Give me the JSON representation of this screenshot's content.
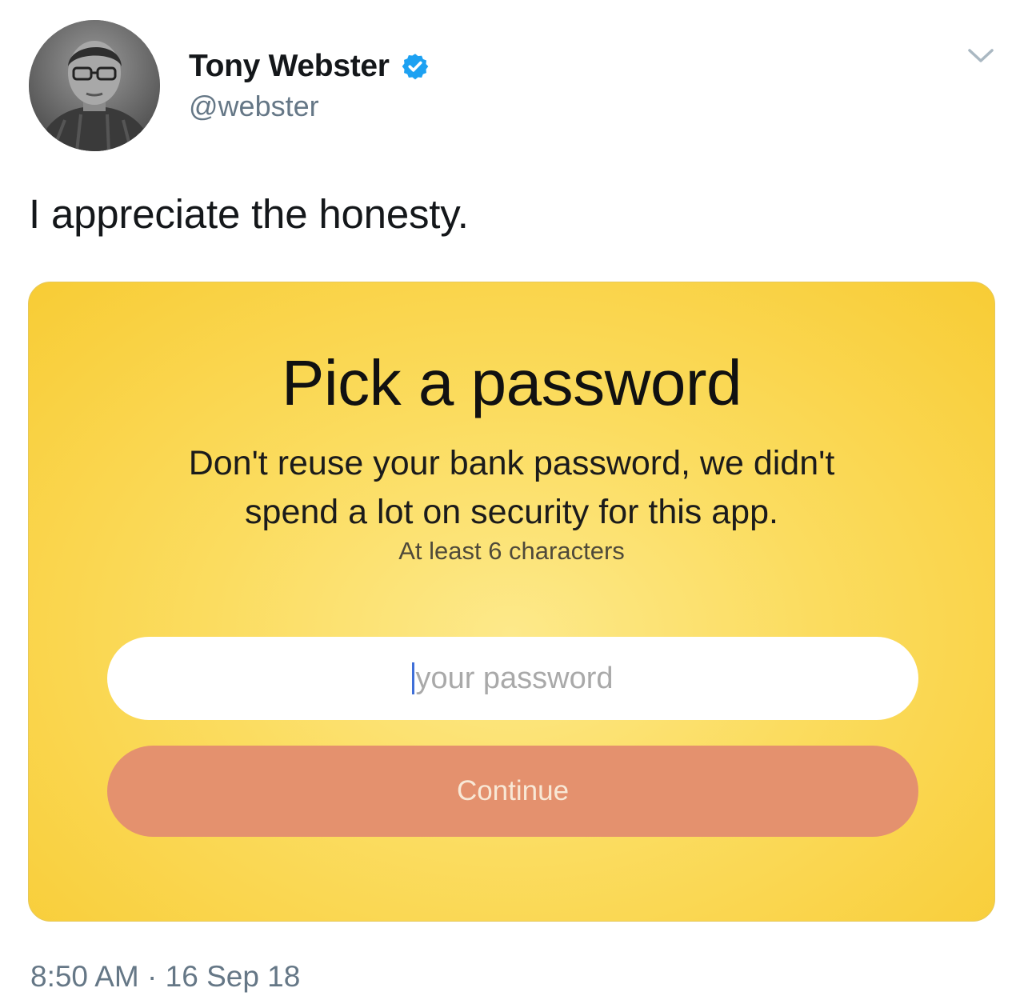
{
  "tweet": {
    "author": {
      "display_name": "Tony Webster",
      "handle": "@webster",
      "verified": true,
      "avatar_icon": "profile-photo",
      "verified_icon": "verified-badge-icon",
      "menu_icon": "chevron-down-icon"
    },
    "text": "I appreciate the honesty.",
    "timestamp": "8:50 AM · 16 Sep 18"
  },
  "media": {
    "title": "Pick a password",
    "description_lines": [
      "Don't reuse your bank password, we didn't",
      "spend a lot on security for this app."
    ],
    "hint": "At least 6 characters",
    "password_input": {
      "value": "",
      "placeholder": "your password"
    },
    "continue_label": "Continue",
    "colors": {
      "background": "#fbdc5f",
      "button": "#e4916e",
      "caret": "#3f6fd8"
    }
  },
  "colors": {
    "text_primary": "#14171a",
    "text_secondary": "#657786",
    "verified_blue": "#1da1f2"
  }
}
